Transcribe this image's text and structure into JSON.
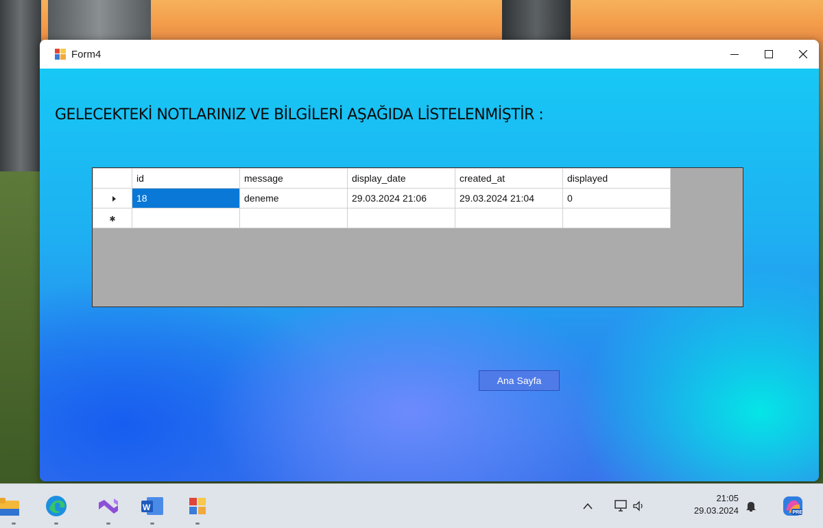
{
  "window": {
    "title": "Form4",
    "heading": "GELECEKTEKİ NOTLARINIZ VE BİLGİLERİ AŞAĞIDA LİSTELENMİŞTİR :",
    "button_label": "Ana Sayfa"
  },
  "grid": {
    "columns": [
      "id",
      "message",
      "display_date",
      "created_at",
      "displayed"
    ],
    "rows": [
      [
        "18",
        "deneme",
        "29.03.2024 21:06",
        "29.03.2024 21:04",
        "0"
      ]
    ]
  },
  "taskbar": {
    "apps": [
      "file-explorer-icon",
      "edge-icon",
      "visual-studio-icon",
      "word-icon",
      "winforms-app-icon"
    ],
    "time": "21:05",
    "date": "29.03.2024"
  },
  "colors": {
    "selected_cell": "#0a78d7",
    "grid_background": "#ababab",
    "button": "#4f7be8"
  }
}
